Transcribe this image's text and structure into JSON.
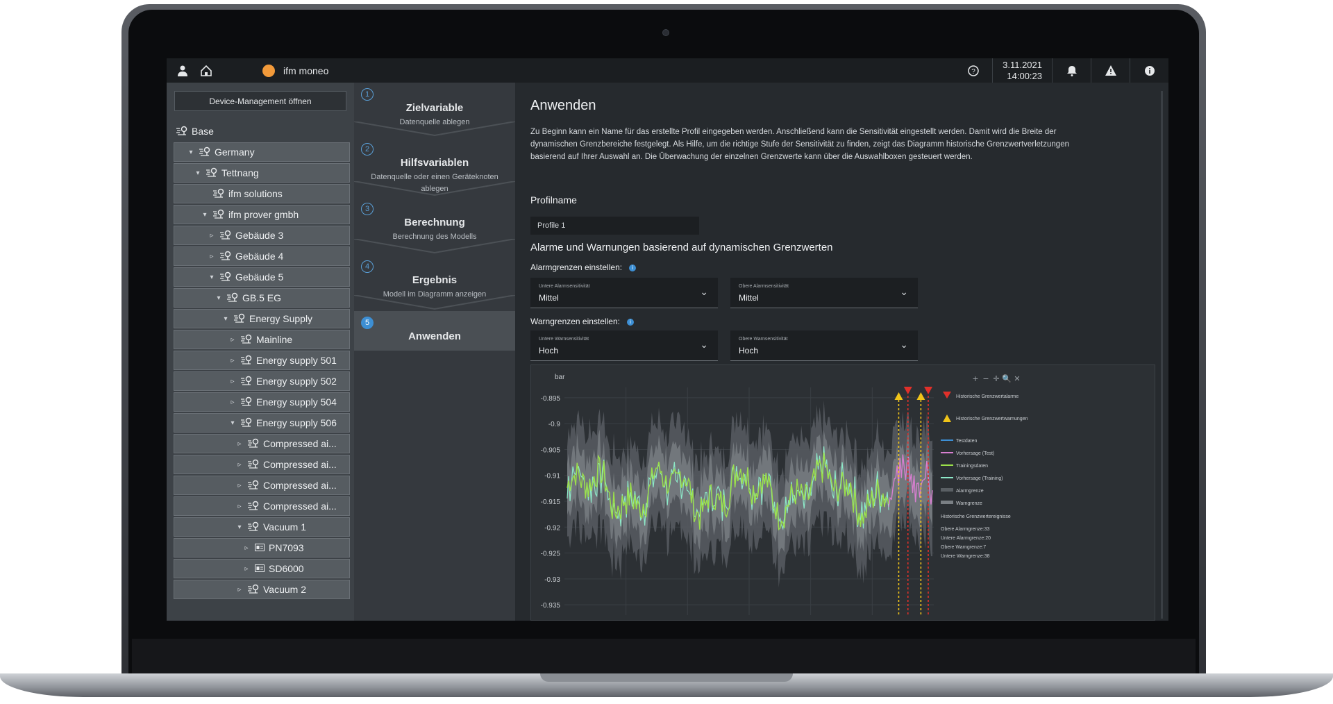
{
  "app": {
    "title": "ifm moneo",
    "date": "3.11.2021",
    "time": "14:00:23"
  },
  "sidebar": {
    "device_management_button": "Device-Management öffnen",
    "tree": [
      {
        "label": "Base",
        "level": 0,
        "caret": "",
        "root": true
      },
      {
        "label": "Germany",
        "level": 1,
        "caret": "▾"
      },
      {
        "label": "Tettnang",
        "level": 2,
        "caret": "▾"
      },
      {
        "label": "ifm solutions",
        "level": 3,
        "caret": ""
      },
      {
        "label": "ifm prover gmbh",
        "level": 3,
        "caret": "▾"
      },
      {
        "label": "Gebäude 3",
        "level": 4,
        "caret": "▹"
      },
      {
        "label": "Gebäude 4",
        "level": 4,
        "caret": "▹"
      },
      {
        "label": "Gebäude 5",
        "level": 4,
        "caret": "▾"
      },
      {
        "label": "GB.5 EG",
        "level": 5,
        "caret": "▾"
      },
      {
        "label": "Energy Supply",
        "level": 6,
        "caret": "▾"
      },
      {
        "label": "Mainline",
        "level": 7,
        "caret": "▹"
      },
      {
        "label": "Energy supply 501",
        "level": 7,
        "caret": "▹"
      },
      {
        "label": "Energy supply 502",
        "level": 7,
        "caret": "▹"
      },
      {
        "label": "Energy supply 504",
        "level": 7,
        "caret": "▹"
      },
      {
        "label": "Energy supply 506",
        "level": 7,
        "caret": "▾"
      },
      {
        "label": "Compressed ai...",
        "level": 8,
        "caret": "▹"
      },
      {
        "label": "Compressed ai...",
        "level": 8,
        "caret": "▹"
      },
      {
        "label": "Compressed ai...",
        "level": 8,
        "caret": "▹"
      },
      {
        "label": "Compressed ai...",
        "level": 8,
        "caret": "▹"
      },
      {
        "label": "Vacuum 1",
        "level": 8,
        "caret": "▾"
      },
      {
        "label": "PN7093",
        "level": 9,
        "caret": "▹",
        "device": true
      },
      {
        "label": "SD6000",
        "level": 9,
        "caret": "▹",
        "device": true
      },
      {
        "label": "Vacuum 2",
        "level": 8,
        "caret": "▹"
      }
    ]
  },
  "steps": [
    {
      "num": "1",
      "title": "Zielvariable",
      "sub": "Datenquelle ablegen"
    },
    {
      "num": "2",
      "title": "Hilfsvariablen",
      "sub": "Datenquelle oder einen Geräteknoten ablegen"
    },
    {
      "num": "3",
      "title": "Berechnung",
      "sub": "Berechnung des Modells"
    },
    {
      "num": "4",
      "title": "Ergebnis",
      "sub": "Modell im Diagramm anzeigen"
    },
    {
      "num": "5",
      "title": "Anwenden",
      "sub": ""
    }
  ],
  "main": {
    "title": "Anwenden",
    "description": "Zu Beginn kann ein Name für das erstellte Profil eingegeben werden. Anschließend kann die Sensitivität eingestellt werden. Damit wird die Breite der dynamischen Grenzbereiche festgelegt. Als Hilfe, um die richtige Stufe der Sensitivität zu finden, zeigt das Diagramm historische Grenzwertverletzungen basierend auf Ihrer Auswahl an. Die Überwachung der einzelnen Grenzwerte kann über die Auswahlboxen gesteuert werden.",
    "profile_label": "Profilname",
    "profile_value": "Profile 1",
    "section_title": "Alarme und Warnungen basierend auf dynamischen Grenzwerten",
    "alarm_label": "Alarmgrenzen einstellen:",
    "warn_label": "Warngrenzen einstellen:",
    "alarm_lower": {
      "label": "Untere Alarmsensitivität",
      "value": "Mittel"
    },
    "alarm_upper": {
      "label": "Obere Alarmsensitivität",
      "value": "Mittel"
    },
    "warn_lower": {
      "label": "Untere Warnsensitivität",
      "value": "Hoch"
    },
    "warn_upper": {
      "label": "Obere Warnsensitivität",
      "value": "Hoch"
    }
  },
  "chart_data": {
    "type": "line",
    "ylabel": "bar",
    "yticks": [
      "-0.895",
      "-0.9",
      "-0.905",
      "-0.91",
      "-0.915",
      "-0.92",
      "-0.925",
      "-0.93",
      "-0.935"
    ],
    "ylim": [
      -0.937,
      -0.893
    ],
    "legend": [
      {
        "label": "Historische Grenzwertalarme",
        "color": "#e0302a",
        "kind": "alarm"
      },
      {
        "label": "Historische Grenzwertwarnungen",
        "color": "#f0c419",
        "kind": "warn"
      },
      {
        "label": "Testdaten",
        "color": "#3d8fd4",
        "kind": "line"
      },
      {
        "label": "Vorhersage (Test)",
        "color": "#d77fd0",
        "kind": "line"
      },
      {
        "label": "Trainingsdaten",
        "color": "#9be04a",
        "kind": "line"
      },
      {
        "label": "Vorhersage (Training)",
        "color": "#8de8c8",
        "kind": "line"
      },
      {
        "label": "Alarmgrenze",
        "color": "#5a5f64",
        "kind": "band"
      },
      {
        "label": "Warngrenze",
        "color": "#7a7f84",
        "kind": "band"
      }
    ],
    "events_title": "Historische Grenzwertereignisse",
    "events": [
      "Obere Alarmgrenze:33",
      "Untere Alarmgrenze:20",
      "Obere Warngrenze:7",
      "Untere Warngrenze:38"
    ],
    "toolbar": [
      "+",
      "−",
      "✛",
      "🔍",
      "✕"
    ]
  }
}
